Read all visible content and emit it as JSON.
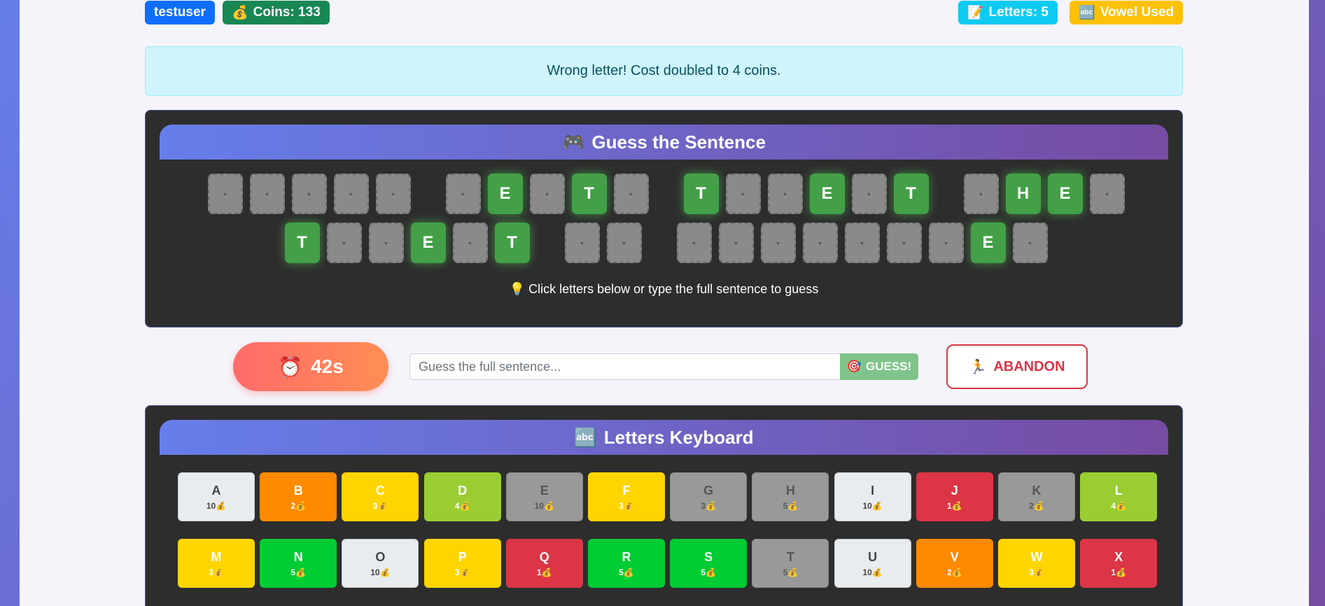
{
  "user": {
    "username": "testuser",
    "coins_label": "Coins: 133",
    "coins_icon": "money-bag-icon"
  },
  "status": {
    "letters_label": "Letters: 5",
    "letters_icon": "memo-icon",
    "vowel_label": "Vowel Used",
    "vowel_icon": "abc-icon"
  },
  "alert": {
    "message": "Wrong letter! Cost doubled to 4 coins."
  },
  "puzzle": {
    "title": "Guess the Sentence",
    "title_icon": "game-controller-icon",
    "hidden_glyph": "•",
    "rows": [
      [
        [
          "",
          "",
          "",
          "",
          ""
        ],
        [
          "",
          "E",
          "",
          "T",
          ""
        ],
        [
          "T",
          "",
          "",
          "E",
          "",
          "T"
        ],
        [
          "",
          "H",
          "E",
          ""
        ]
      ],
      [
        [
          "T",
          "",
          "",
          "E",
          "",
          "T"
        ],
        [
          "",
          ""
        ],
        [
          "",
          "",
          "",
          "",
          "",
          "",
          "",
          "E",
          ""
        ]
      ]
    ],
    "hint": "Click letters below or type the full sentence to guess",
    "hint_icon": "lightbulb-icon"
  },
  "timer": {
    "value": "42s",
    "icon": "alarm-clock-icon"
  },
  "guess": {
    "placeholder": "Guess the full sentence...",
    "button_label": "GUESS!",
    "button_icon": "target-icon"
  },
  "abandon": {
    "label": "ABANDON",
    "icon": "running-person-icon"
  },
  "keyboard": {
    "title": "Letters Keyboard",
    "title_icon": "abc-icon",
    "cost_icon": "money-bag-icon",
    "rows": [
      [
        {
          "letter": "A",
          "cost": "10",
          "state": "light"
        },
        {
          "letter": "B",
          "cost": "2",
          "state": "orange"
        },
        {
          "letter": "C",
          "cost": "3",
          "state": "yellow"
        },
        {
          "letter": "D",
          "cost": "4",
          "state": "lime"
        },
        {
          "letter": "E",
          "cost": "10",
          "state": "gray"
        },
        {
          "letter": "F",
          "cost": "3",
          "state": "yellow"
        },
        {
          "letter": "G",
          "cost": "3",
          "state": "gray"
        },
        {
          "letter": "H",
          "cost": "5",
          "state": "gray"
        },
        {
          "letter": "I",
          "cost": "10",
          "state": "light"
        },
        {
          "letter": "J",
          "cost": "1",
          "state": "red"
        },
        {
          "letter": "K",
          "cost": "2",
          "state": "gray"
        },
        {
          "letter": "L",
          "cost": "4",
          "state": "lime"
        }
      ],
      [
        {
          "letter": "M",
          "cost": "3",
          "state": "yellow"
        },
        {
          "letter": "N",
          "cost": "5",
          "state": "green"
        },
        {
          "letter": "O",
          "cost": "10",
          "state": "light"
        },
        {
          "letter": "P",
          "cost": "3",
          "state": "yellow"
        },
        {
          "letter": "Q",
          "cost": "1",
          "state": "red"
        },
        {
          "letter": "R",
          "cost": "5",
          "state": "green"
        },
        {
          "letter": "S",
          "cost": "5",
          "state": "green"
        },
        {
          "letter": "T",
          "cost": "5",
          "state": "gray"
        },
        {
          "letter": "U",
          "cost": "10",
          "state": "light"
        },
        {
          "letter": "V",
          "cost": "2",
          "state": "orange"
        },
        {
          "letter": "W",
          "cost": "3",
          "state": "yellow"
        },
        {
          "letter": "X",
          "cost": "1",
          "state": "red"
        }
      ]
    ]
  },
  "colors": {
    "accent_gradient_start": "#667eea",
    "accent_gradient_end": "#764ba2",
    "revealed_tile": "#43a047",
    "hidden_tile": "#8a8a8a"
  }
}
